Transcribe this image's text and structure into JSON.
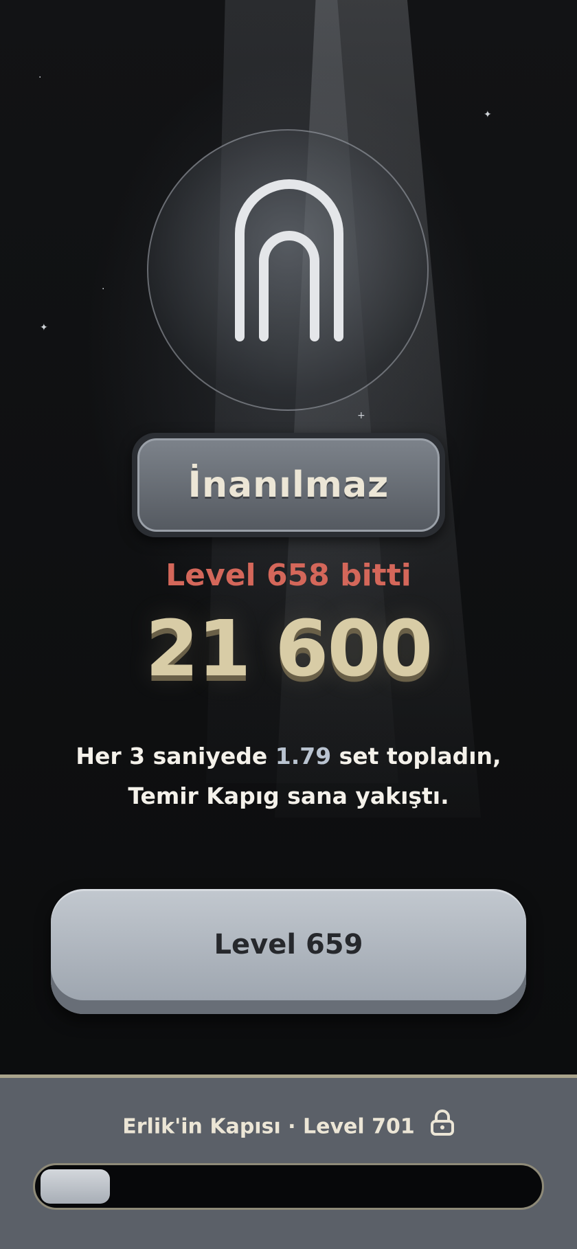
{
  "rank_badge": {
    "label": "İnanılmaz",
    "emblem_icon": "arch-icon"
  },
  "result": {
    "level_done": "Level 658 bitti",
    "score": "21 600"
  },
  "message": {
    "line1_prefix": "Her 3 saniyede ",
    "line1_highlight": "1.79",
    "line1_suffix": " set topladın,",
    "line2": "Temir Kapıg sana yakıştı."
  },
  "next_button": {
    "label": "Level 659"
  },
  "progress_panel": {
    "title": "Erlik'in Kapısı · Level 701",
    "lock_icon": "lock-icon",
    "progress_fraction": 0.14
  },
  "colors": {
    "level_done": "#d4675a",
    "score": "#d8cca6",
    "highlight": "#b9c3d0",
    "panel": "#5b6068"
  }
}
